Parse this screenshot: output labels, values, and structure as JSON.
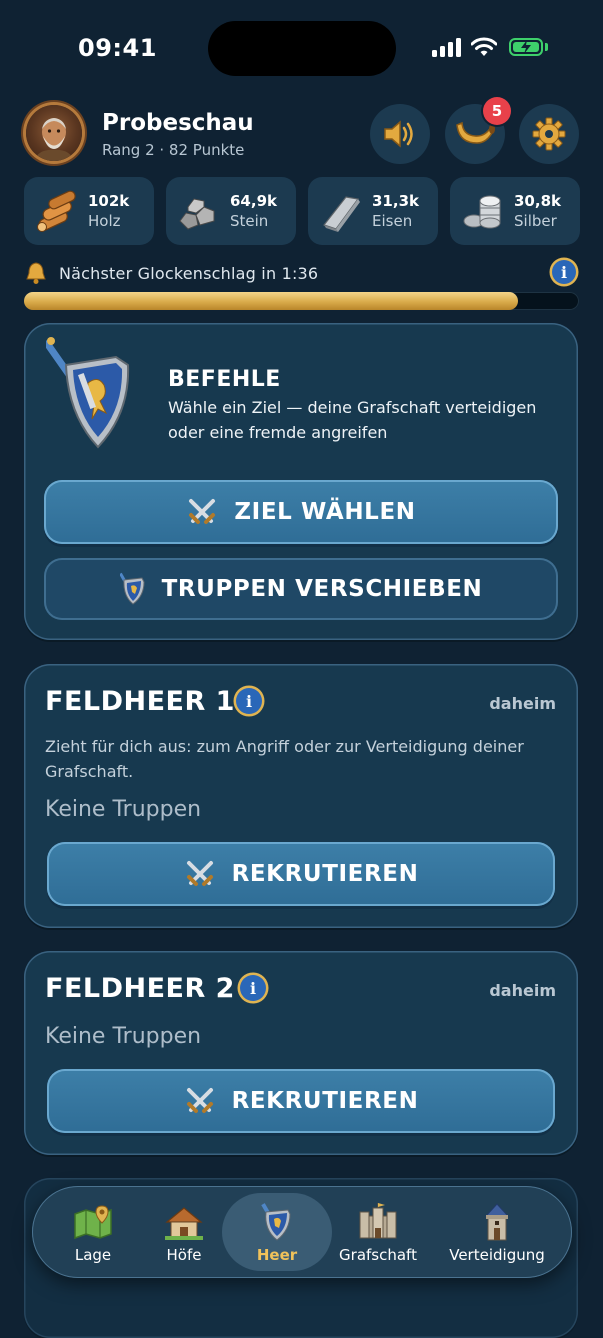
{
  "status_bar": {
    "time": "09:41"
  },
  "header": {
    "player_name": "Probeschau",
    "player_sub": "Rang 2 · 82 Punkte",
    "buttons": [
      "sound-icon",
      "horn-icon",
      "gear-icon"
    ],
    "notification_count": "5"
  },
  "resources": [
    {
      "icon": "wood-icon",
      "value": "102k",
      "name": "Holz"
    },
    {
      "icon": "stone-icon",
      "value": "64,9k",
      "name": "Stein"
    },
    {
      "icon": "iron-icon",
      "value": "31,3k",
      "name": "Eisen"
    },
    {
      "icon": "silver-icon",
      "value": "30,8k",
      "name": "Silber"
    }
  ],
  "timer": {
    "text": "Nächster Glockenschlag in 1:36",
    "progress": 0.89
  },
  "orders": {
    "title": "BEFEHLE",
    "subtitle": "Wähle ein Ziel — deine Grafschaft verteidigen oder eine fremde angreifen",
    "primary_label": "ZIEL WÄHLEN",
    "secondary_label": "TRUPPEN VERSCHIEBEN"
  },
  "armies": [
    {
      "title": "FELDHEER 1",
      "status": "daheim",
      "description": "Zieht für dich aus: zum Angriff oder zur Verteidigung deiner Grafschaft.",
      "empty_text": "Keine Truppen",
      "button_label": "REKRUTIEREN"
    },
    {
      "title": "FELDHEER 2",
      "status": "daheim",
      "empty_text": "Keine Truppen",
      "button_label": "REKRUTIEREN"
    }
  ],
  "info_glyph": "i",
  "nav": {
    "active": "Heer",
    "items": [
      {
        "label": "Lage",
        "icon": "map-icon"
      },
      {
        "label": "Höfe",
        "icon": "farm-icon"
      },
      {
        "label": "Heer",
        "icon": "shield-icon"
      },
      {
        "label": "Grafschaft",
        "icon": "castle-icon"
      },
      {
        "label": "Verteidigung",
        "icon": "tower-icon"
      }
    ]
  },
  "colors": {
    "background": "#0f2233",
    "card": "#17394f",
    "accent_gold": "#d9ab4a",
    "button_blue": "#3d7fa8",
    "badge_red": "#e8414a"
  }
}
